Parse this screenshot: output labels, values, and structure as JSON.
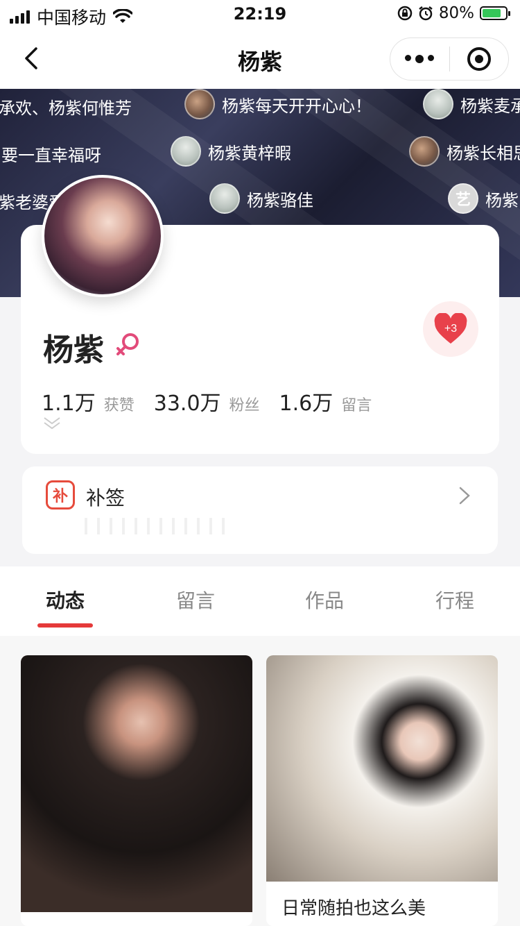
{
  "status_bar": {
    "carrier": "中国移动",
    "time": "22:19",
    "battery_percent": "80%"
  },
  "nav": {
    "title": "杨紫"
  },
  "barrage": [
    {
      "text": "承欢、杨紫何惟芳"
    },
    {
      "text": "杨紫每天开开心心！"
    },
    {
      "text": "杨紫麦承"
    },
    {
      "text": "要一直幸福呀"
    },
    {
      "text": "杨紫黄梓暇"
    },
    {
      "text": "杨紫长相思"
    },
    {
      "text": "紫老婆爱"
    },
    {
      "text": "杨紫骆佳"
    },
    {
      "text": "杨紫"
    }
  ],
  "barrage_badge": "艺",
  "profile": {
    "name": "杨紫",
    "heart_badge": "+3",
    "stats": [
      {
        "value": "1.1万",
        "label": "获赞"
      },
      {
        "value": "33.0万",
        "label": "粉丝"
      },
      {
        "value": "1.6万",
        "label": "留言"
      }
    ]
  },
  "supplement": {
    "icon_text": "补",
    "label": "补签"
  },
  "tabs": [
    {
      "label": "动态",
      "active": true
    },
    {
      "label": "留言",
      "active": false
    },
    {
      "label": "作品",
      "active": false
    },
    {
      "label": "行程",
      "active": false
    }
  ],
  "posts": [
    {
      "caption": ""
    },
    {
      "caption": "日常随拍也这么美"
    }
  ],
  "colors": {
    "accent_red": "#e53a3a",
    "supp_red": "#e64b3c",
    "gender_pink": "#e24b7a"
  }
}
